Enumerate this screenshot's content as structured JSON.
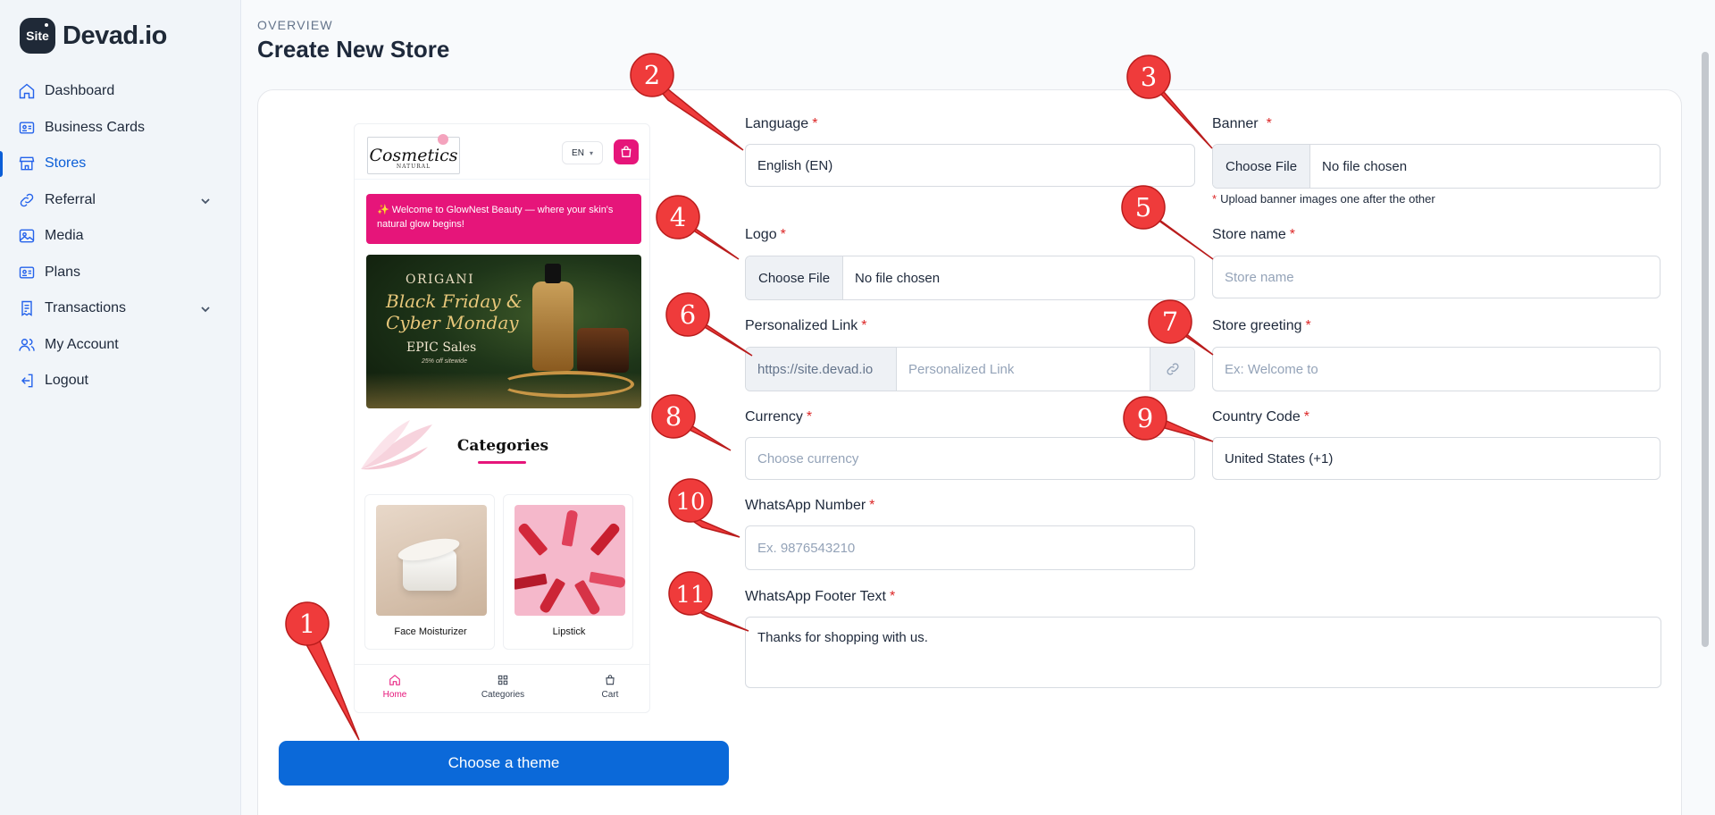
{
  "brand": {
    "badge": "Site",
    "name": "Devad.io"
  },
  "sidebar": {
    "items": [
      {
        "label": "Dashboard",
        "icon": "home-icon"
      },
      {
        "label": "Business Cards",
        "icon": "id-card-icon"
      },
      {
        "label": "Stores",
        "icon": "store-icon",
        "active": true
      },
      {
        "label": "Referral",
        "icon": "link-icon",
        "expandable": true
      },
      {
        "label": "Media",
        "icon": "image-icon"
      },
      {
        "label": "Plans",
        "icon": "id-card-icon"
      },
      {
        "label": "Transactions",
        "icon": "receipt-icon",
        "expandable": true
      },
      {
        "label": "My Account",
        "icon": "users-icon"
      },
      {
        "label": "Logout",
        "icon": "logout-icon"
      }
    ]
  },
  "header": {
    "overline": "OVERVIEW",
    "title": "Create New Store"
  },
  "preview": {
    "logo_text": "Cosmetics",
    "logo_sub": "NATURAL",
    "lang": "EN",
    "welcome": "✨ Welcome to GlowNest Beauty — where your skin's natural glow begins!",
    "banner": {
      "line1": "ORIGANI",
      "line2": "Black Friday &",
      "line3": "Cyber Monday",
      "line4": "EPIC Sales",
      "line5": "25% off sitewide"
    },
    "categories_title": "Categories",
    "products": [
      {
        "name": "Face Moisturizer"
      },
      {
        "name": "Lipstick"
      }
    ],
    "nav": [
      {
        "label": "Home"
      },
      {
        "label": "Categories"
      },
      {
        "label": "Cart"
      }
    ]
  },
  "theme_button": "Choose a theme",
  "form": {
    "language": {
      "label": "Language",
      "value": "English (EN)"
    },
    "banner": {
      "label": "Banner",
      "button": "Choose File",
      "status": "No file chosen",
      "hint": "Upload banner images one after the other"
    },
    "logo": {
      "label": "Logo",
      "button": "Choose File",
      "status": "No file chosen"
    },
    "store_name": {
      "label": "Store name",
      "placeholder": "Store name"
    },
    "personalized_link": {
      "label": "Personalized Link",
      "prefix": "https://site.devad.io",
      "placeholder": "Personalized Link"
    },
    "store_greeting": {
      "label": "Store greeting",
      "placeholder": "Ex: Welcome to"
    },
    "currency": {
      "label": "Currency",
      "placeholder": "Choose currency"
    },
    "country_code": {
      "label": "Country Code",
      "value": "United States (+1)"
    },
    "whatsapp_number": {
      "label": "WhatsApp Number",
      "placeholder": "Ex. 9876543210"
    },
    "whatsapp_footer": {
      "label": "WhatsApp Footer Text",
      "value": "Thanks for shopping with us."
    },
    "required_mark": "*"
  },
  "annotations": {
    "color": "#ef3b3b",
    "markers": [
      "1",
      "2",
      "3",
      "4",
      "5",
      "6",
      "7",
      "8",
      "9",
      "10",
      "11"
    ]
  }
}
